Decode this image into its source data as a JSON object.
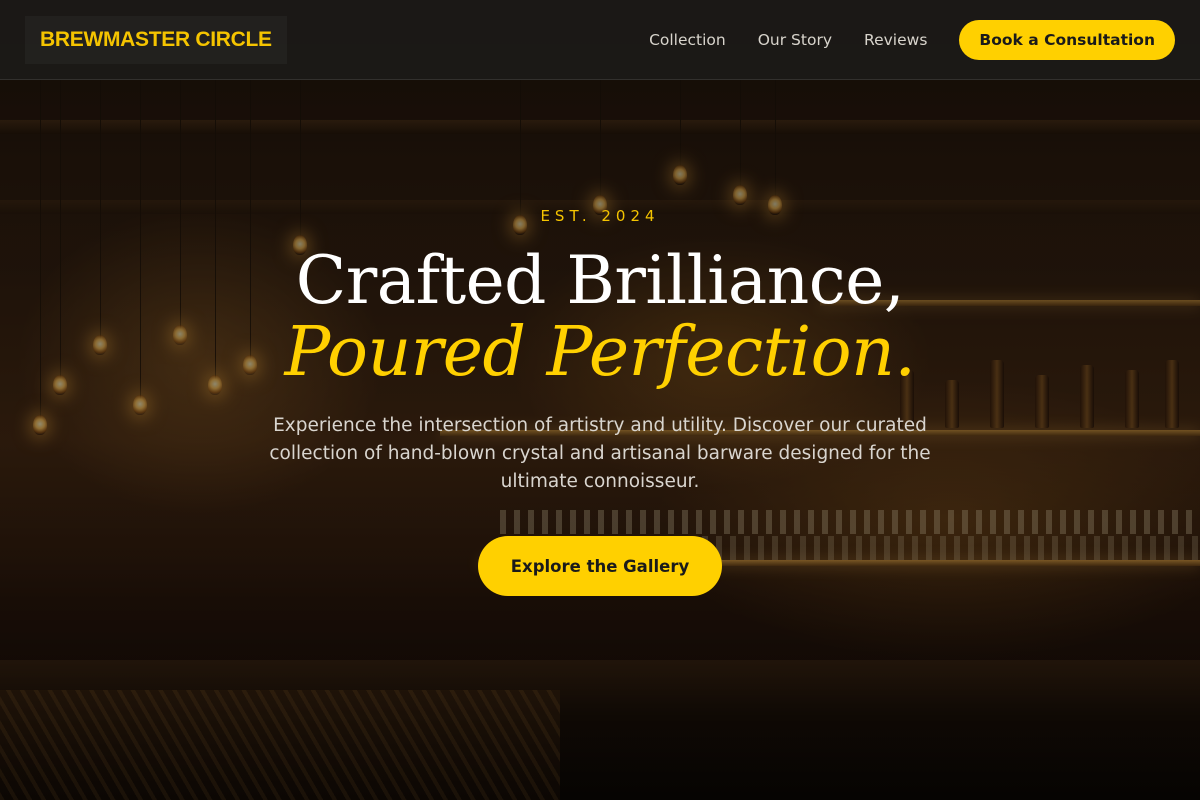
{
  "nav": {
    "brand": "BREWMASTER CIRCLE",
    "links": [
      "Collection",
      "Our Story",
      "Reviews"
    ],
    "cta": "Book a Consultation"
  },
  "hero": {
    "eyebrow": "EST. 2024",
    "headline": "Crafted Brilliance,",
    "headline_accent": "Poured Perfection.",
    "lead": "Experience the intersection of artistry and utility. Discover our curated collection of hand-blown crystal and artisanal barware designed for the ultimate connoisseur.",
    "cta": "Explore the Gallery"
  },
  "colors": {
    "accent": "#ffd000",
    "navbar_bg": "#1c1a18"
  }
}
